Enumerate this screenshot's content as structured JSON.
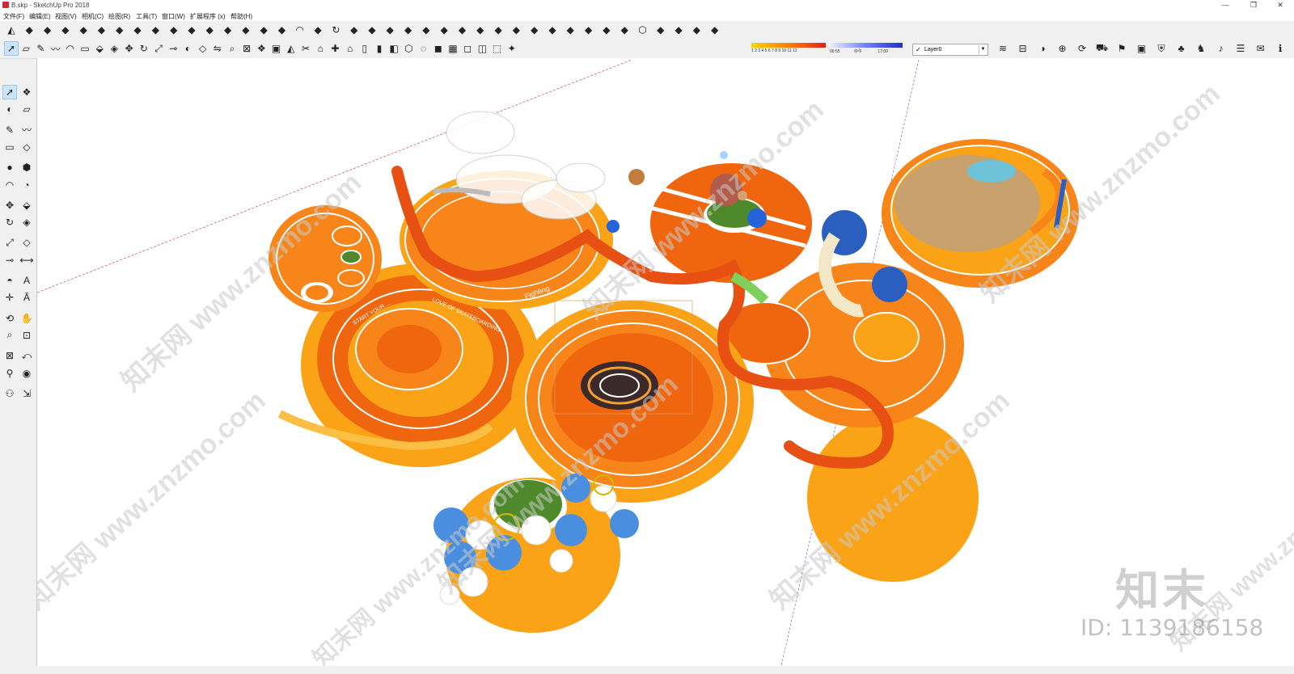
{
  "window": {
    "title": "B.skp - SketchUp Pro 2018",
    "minimize": "—",
    "restore": "❐",
    "close": "✕"
  },
  "menu": [
    "文件(F)",
    "编辑(E)",
    "视图(V)",
    "相机(C)",
    "绘图(R)",
    "工具(T)",
    "窗口(W)",
    "扩展程序 (x)",
    "帮助(H)"
  ],
  "layer_box": {
    "check": "✓",
    "value": "Layer0"
  },
  "shadow": {
    "months": "1 2 3 4 5 6 7 8 9 10 11 12",
    "time_start": "06:55",
    "time_mid": "中午",
    "time_end": "17:00"
  },
  "icons": {
    "row1": [
      "sandbox-icon",
      "grid-icon",
      "ramp-icon",
      "bars-icon",
      "curve-tool-icon",
      "bend-icon",
      "pipe-icon",
      "pen-icon",
      "hand-icon",
      "loop-icon",
      "twist-icon",
      "lens-icon",
      "leaf-icon",
      "layers-icon",
      "box-select-icon",
      "cube-icon",
      "arc-icon",
      "wave-icon",
      "rotate-icon",
      "sweep-icon",
      "sail-icon",
      "steps-icon",
      "temple-icon",
      "shade-icon",
      "grid-dots-icon",
      "column-icon",
      "bottle-icon",
      "ruler-icon",
      "camera-icon",
      "bowl-icon",
      "solid-icon",
      "wire-icon",
      "hex-icon",
      "bevel-icon",
      "stack-icon",
      "iso-icon",
      "table-icon",
      "check-icon",
      "ring-icon",
      "block-icon"
    ],
    "row2": [
      "select-icon",
      "eraser-icon",
      "pencil-icon",
      "freehand-icon",
      "arc-icon",
      "rect-icon",
      "push-pull-icon",
      "follow-me-icon",
      "move-icon",
      "rotate-icon",
      "scale-icon",
      "tape-icon",
      "paint-icon",
      "offset-icon",
      "flip-icon",
      "zoom-icon",
      "zoom-extents-icon",
      "component-icon",
      "group-icon",
      "sandbox-icon",
      "cut-icon",
      "warehouse-icon",
      "extension-icon",
      "home-icon",
      "front-icon",
      "back-icon",
      "left-icon",
      "iso-icon",
      "xray-icon",
      "shaded-icon",
      "textured-icon",
      "monochrome-icon",
      "hidden-line-icon",
      "wireframe-icon",
      "style-icon",
      "fog-icon",
      "section-icon",
      "shadow-toggle-icon",
      "geo-icon",
      "update-icon",
      "car-icon",
      "sign-icon",
      "photo-icon",
      "shield-icon",
      "tree-icon",
      "chess-icon",
      "speaker-icon",
      "settings-icon",
      "chat-icon",
      "info-icon"
    ],
    "left": [
      "select-icon",
      "component-icon",
      "paint-icon",
      "eraser-icon",
      "pencil-icon",
      "freehand-icon",
      "rect-icon",
      "rotated-rect-icon",
      "circle-icon",
      "polygon-icon",
      "arc-icon",
      "pie-icon",
      "move-icon",
      "push-pull-icon",
      "rotate-icon",
      "follow-me-icon",
      "scale-icon",
      "offset-icon",
      "tape-icon",
      "dimension-icon",
      "protractor-icon",
      "text-icon",
      "axes-icon",
      "3d-text-icon",
      "orbit-icon",
      "pan-icon",
      "zoom-icon",
      "zoom-window-icon",
      "zoom-extents-icon",
      "previous-view-icon",
      "position-camera-icon",
      "look-around-icon",
      "walk-icon",
      "section-plane-icon"
    ]
  },
  "scene": {
    "labels": {
      "arc_text_1": "START YOUR ...",
      "arc_text_2": "LOVE OF SKATEBOARDING",
      "fighting": "Fighting"
    },
    "colors": {
      "orange_dark": "#f0660f",
      "orange_mid": "#f7851a",
      "orange_light": "#fba317",
      "green": "#4e8a2c",
      "blue": "#4a8ee0",
      "wood": "#c8a16d",
      "sky": "#6dc2d8"
    }
  },
  "watermarks": [
    "知末网 www.znzmo.com",
    "知末网 www.znzmo.com",
    "知末网 www.znzmo.com",
    "知末网 www.znzmo.com",
    "知末网 www.znzmo.com",
    "知末网 www.znzmo.com",
    "知末网 www.znzmo.com",
    "知末网 www.znzmo.com"
  ],
  "brand": {
    "logo": "知末",
    "id": "ID: 1139186158"
  }
}
